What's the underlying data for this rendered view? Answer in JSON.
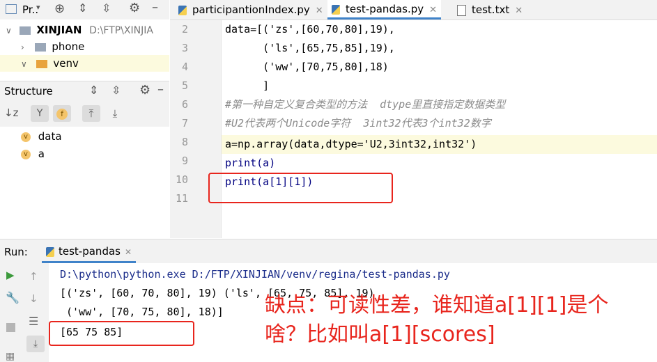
{
  "project_toolbar": {
    "title": "Pr.."
  },
  "project_tree": {
    "root_name": "XINJIAN",
    "root_path": "D:\\FTP\\XINJIA",
    "items": [
      {
        "label": "phone"
      },
      {
        "label": "venv"
      }
    ]
  },
  "structure": {
    "title": "Structure",
    "items": [
      {
        "badge": "v",
        "label": "data"
      },
      {
        "badge": "v",
        "label": "a"
      }
    ]
  },
  "editor_tabs": [
    {
      "label": "participantionIndex.py",
      "active": false
    },
    {
      "label": "test-pandas.py",
      "active": true
    },
    {
      "label": "test.txt",
      "active": false
    }
  ],
  "code_lines": [
    {
      "number": "2",
      "text": "data=[('zs',[60,70,80],19),"
    },
    {
      "number": "3",
      "text": "      ('ls',[65,75,85],19),"
    },
    {
      "number": "4",
      "text": "      ('ww',[70,75,80],18)"
    },
    {
      "number": "5",
      "text": "      ]"
    },
    {
      "number": "6",
      "text": "#第一种自定义复合类型的方法  dtype里直接指定数据类型"
    },
    {
      "number": "7",
      "text": "#U2代表两个Unicode字符  3int32代表3个int32数字"
    },
    {
      "number": "8",
      "text": "a=np.array(data,dtype='U2,3int32,int32')"
    },
    {
      "number": "9",
      "text": "print(a)"
    },
    {
      "number": "10",
      "text": "print(a[1][1])"
    },
    {
      "number": "11",
      "text": ""
    }
  ],
  "run": {
    "label": "Run:",
    "tab_label": "test-pandas",
    "output_lines": [
      "D:\\python\\python.exe D:/FTP/XINJIAN/venv/regina/test-pandas.py",
      "[('zs', [60, 70, 80], 19) ('ls', [65, 75, 85], 19)",
      " ('ww', [70, 75, 80], 18)]",
      "[65 75 85]"
    ]
  },
  "annotation": {
    "line1": "缺点：可读性差，谁知道a[1][1]是个",
    "line2": "啥？比如叫a[1][scores]"
  },
  "colors": {
    "accent_red": "#e8251d",
    "keyword": "#660099",
    "number": "#1750eb",
    "string": "#067d17",
    "comment": "#8c8c8c",
    "current_line": "#fcfade"
  }
}
